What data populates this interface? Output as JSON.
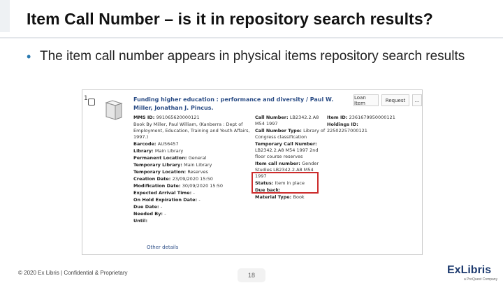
{
  "slide": {
    "title": "Item Call Number – is it in repository search results?",
    "bullet": "The item call number appears in physical items repository search results"
  },
  "record": {
    "number": "1",
    "title": "Funding higher education : performance and diversity / Paul W. Miller, Jonathan J. Pincus.",
    "buttons": {
      "loan": "Loan Item",
      "request": "Request",
      "more": "..."
    },
    "col1": [
      {
        "label": "MMS ID:",
        "value": "991065620000121"
      },
      {
        "label": "",
        "value": "Book By Miller, Paul William, (Kanberra : Dept of Employment, Education, Training and Youth Affairs, 1997.)"
      },
      {
        "label": "Barcode:",
        "value": "AU56457"
      },
      {
        "label": "Library:",
        "value": "Main Library"
      },
      {
        "label": "Permanent Location:",
        "value": "General"
      },
      {
        "label": "Temporary Library:",
        "value": "Main Library"
      },
      {
        "label": "Temporary Location:",
        "value": "Reserves"
      },
      {
        "label": "Creation Date:",
        "value": "23/09/2020 15:50"
      },
      {
        "label": "Modification Date:",
        "value": "30/09/2020 15:50"
      },
      {
        "label": "Expected Arrival Time:",
        "value": "-"
      },
      {
        "label": "On Hold Expiration Date:",
        "value": "-"
      },
      {
        "label": "Due Date:",
        "value": "-"
      },
      {
        "label": "Needed By:",
        "value": "-"
      },
      {
        "label": "Until:",
        "value": ""
      }
    ],
    "col2": [
      {
        "label": "Call Number:",
        "value": "LB2342.2.A8 M54 1997"
      },
      {
        "label": "Call Number Type:",
        "value": "Library of Congress classification"
      },
      {
        "label": "Temporary Call Number:",
        "value": "LB2342.2.A8 M54 1997 2nd floor course reserves"
      },
      {
        "label": "Item call number:",
        "value": "Gender Studies LB2342.2.A8 M54 1997"
      },
      {
        "label": "Status:",
        "value": "Item in place"
      },
      {
        "label": "Due back:",
        "value": ""
      },
      {
        "label": "Material Type:",
        "value": "Book"
      }
    ],
    "col3": [
      {
        "label": "Item ID:",
        "value": "2361679950000121"
      },
      {
        "label": "Holdings ID:",
        "value": "22502257000121"
      }
    ],
    "other_details": "Other details"
  },
  "footer": {
    "copyright": "© 2020 Ex Libris | Confidential & Proprietary",
    "page": "18",
    "logo": "ExLibris",
    "logo_sub": "a ProQuest Company"
  },
  "colors": {
    "highlight": "#cc2b2b",
    "link": "#2b4d86",
    "brand": "#1e3b6f"
  }
}
